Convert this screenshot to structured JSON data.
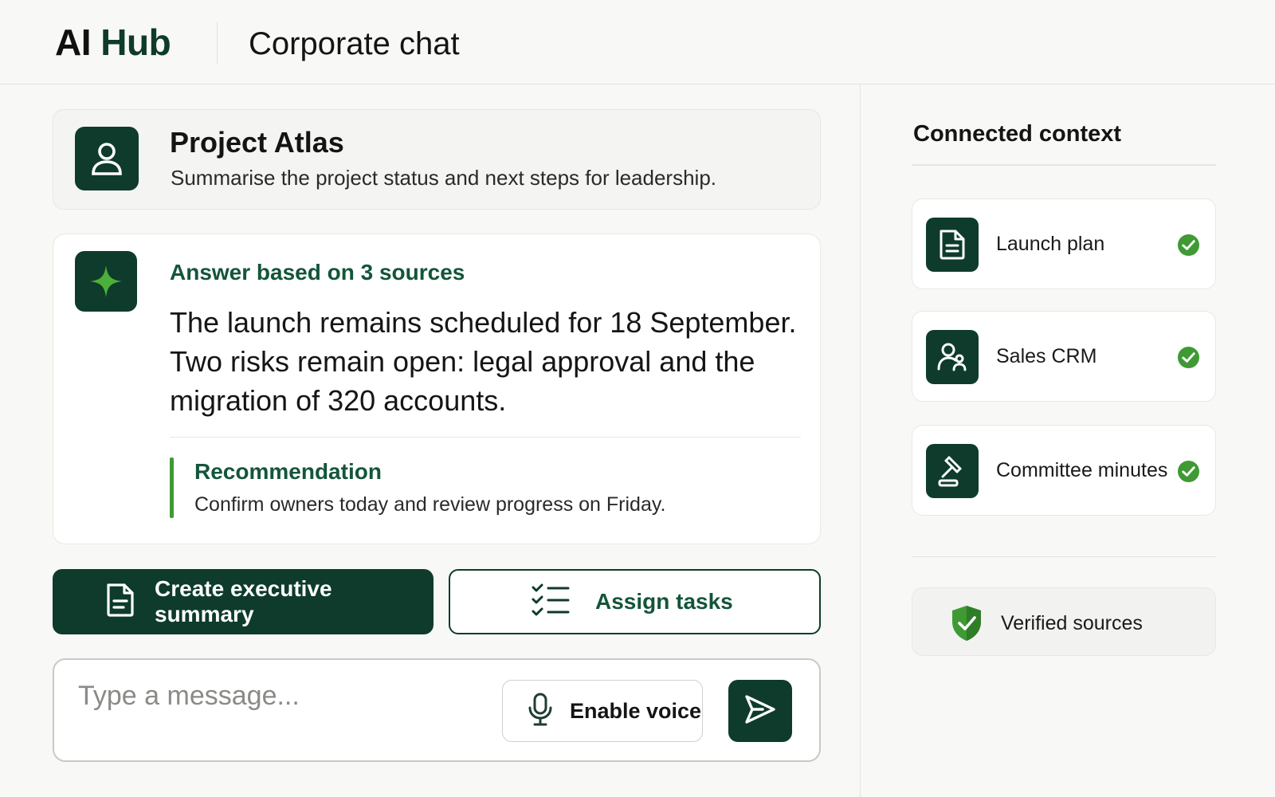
{
  "header": {
    "brand_ai": "AI",
    "brand_hub": "Hub",
    "title": "Corporate chat"
  },
  "project": {
    "title": "Project Atlas",
    "prompt": "Summarise the project status and next steps for leadership.",
    "icon": "user-icon"
  },
  "answer": {
    "label": "Answer based on 3 sources",
    "body": "The launch remains scheduled for 18 September. Two risks remain open: legal approval and the migration of 320 accounts.",
    "icon": "sparkle-icon",
    "recommendation": {
      "title": "Recommendation",
      "body": "Confirm owners today and review progress on Friday."
    }
  },
  "actions": {
    "primary_label": "Create executive summary",
    "primary_icon": "document-icon",
    "secondary_label": "Assign tasks",
    "secondary_icon": "checklist-icon"
  },
  "composer": {
    "placeholder": "Type a message...",
    "value": "",
    "voice_label": "Enable voice",
    "voice_icon": "microphone-icon",
    "send_icon": "send-icon"
  },
  "context": {
    "title": "Connected context",
    "items": [
      {
        "label": "Launch plan",
        "icon": "document-icon",
        "status": "connected"
      },
      {
        "label": "Sales CRM",
        "icon": "users-icon",
        "status": "connected"
      },
      {
        "label": "Committee minutes",
        "icon": "gavel-icon",
        "status": "connected"
      }
    ],
    "verified_label": "Verified sources",
    "verified_icon": "shield-check-icon"
  },
  "colors": {
    "brand_dark": "#0e3b2c",
    "accent_green": "#14553a",
    "success_green": "#3f9a34",
    "background": "#f8f8f6"
  }
}
